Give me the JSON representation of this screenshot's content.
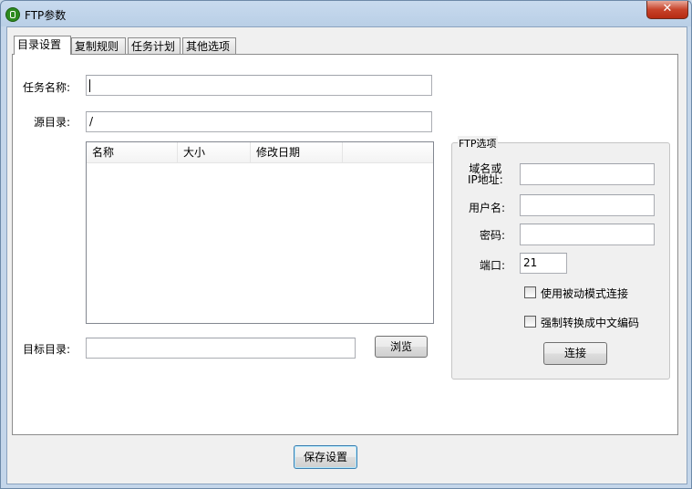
{
  "window": {
    "title": "FTP参数",
    "close_label": "✕"
  },
  "tabs": [
    {
      "label": "目录设置",
      "active": true
    },
    {
      "label": "复制规则",
      "active": false
    },
    {
      "label": "任务计划",
      "active": false
    },
    {
      "label": "其他选项",
      "active": false
    }
  ],
  "directory": {
    "task_name_label": "任务名称:",
    "task_name_value": "",
    "source_label": "源目录:",
    "source_value": "/",
    "columns": [
      "名称",
      "大小",
      "修改日期",
      ""
    ],
    "target_label": "目标目录:",
    "target_value": "",
    "browse_label": "浏览"
  },
  "ftp": {
    "group_title": "FTP选项",
    "domain_label_line1": "域名或",
    "domain_label_line2": "IP地址:",
    "domain_value": "",
    "username_label": "用户名:",
    "username_value": "",
    "password_label": "密码:",
    "password_value": "",
    "port_label": "端口:",
    "port_value": "21",
    "passive_label": "使用被动模式连接",
    "passive_checked": false,
    "force_chinese_label": "强制转换成中文编码",
    "force_chinese_checked": false,
    "connect_label": "连接"
  },
  "footer": {
    "save_label": "保存设置"
  }
}
